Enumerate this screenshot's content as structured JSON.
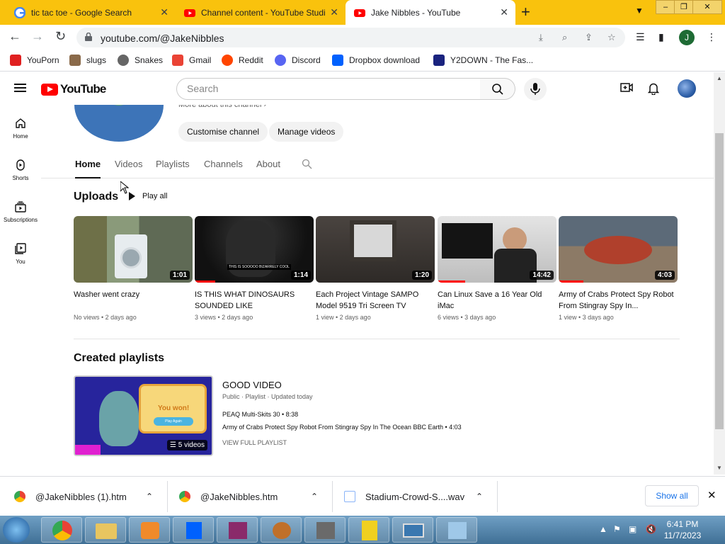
{
  "browser": {
    "tabs": [
      {
        "title": "tic tac toe - Google Search",
        "icon": "google-icon"
      },
      {
        "title": "Channel content - YouTube Studio",
        "icon": "youtube-icon"
      },
      {
        "title": "Jake Nibbles - YouTube",
        "icon": "youtube-icon",
        "active": true
      }
    ],
    "url": "youtube.com/@JakeNibbles",
    "profile_initial": "J",
    "bookmarks": [
      "YouPorn",
      "slugs",
      "Snakes",
      "Gmail",
      "Reddit",
      "Discord",
      "Dropbox download",
      "Y2DOWN - The Fas..."
    ]
  },
  "youtube": {
    "logo": "YouTube",
    "search_placeholder": "Search",
    "guide": [
      "Home",
      "Shorts",
      "Subscriptions",
      "You"
    ],
    "channel": {
      "more_about": "More about this channel",
      "customise_label": "Customise channel",
      "manage_label": "Manage videos",
      "tabs": [
        "Home",
        "Videos",
        "Playlists",
        "Channels",
        "About"
      ]
    },
    "uploads": {
      "heading": "Uploads",
      "play_all": "Play all",
      "videos": [
        {
          "title": "Washer went crazy",
          "duration": "1:01",
          "meta": "No views • 2 days ago",
          "progress": 0
        },
        {
          "title": "IS THIS WHAT DINOSAURS SOUNDED LIKE",
          "duration": "1:14",
          "meta": "3 views • 2 days ago",
          "progress": 0.17,
          "caption": "THIS IS SOOOOO BIZARRELY COOL"
        },
        {
          "title": "Each Project Vintage SAMPO Model 9519 Tri Screen TV",
          "duration": "1:20",
          "meta": "1 view • 2 days ago",
          "progress": 0
        },
        {
          "title": "Can Linux Save a 16 Year Old iMac",
          "duration": "14:42",
          "meta": "6 views • 3 days ago",
          "progress": 0.23
        },
        {
          "title": "Army of Crabs Protect Spy Robot From Stingray Spy In...",
          "duration": "4:03",
          "meta": "1 view • 3 days ago",
          "progress": 0.21
        }
      ]
    },
    "playlists": {
      "heading": "Created playlists",
      "title": "GOOD VIDEO",
      "meta": "Public · Playlist · Updated today",
      "count": "5 videos",
      "thumb_text": "You won!",
      "thumb_button": "Play Again",
      "items": [
        "PEAQ Multi-Skits 30 • 8:38",
        "Army of Crabs Protect Spy Robot From Stingray Spy In The Ocean BBC Earth • 4:03"
      ],
      "view_full": "VIEW FULL PLAYLIST"
    }
  },
  "downloads": {
    "items": [
      "@JakeNibbles (1).htm",
      "@JakeNibbles.htm",
      "Stadium-Crowd-S....wav"
    ],
    "show_all": "Show all"
  },
  "taskbar": {
    "time": "6:41 PM",
    "date": "11/7/2023"
  },
  "colors": {
    "tabstrip": "#f9c20d",
    "yt_red": "#ff0000",
    "download_blue": "#1a73e8"
  }
}
